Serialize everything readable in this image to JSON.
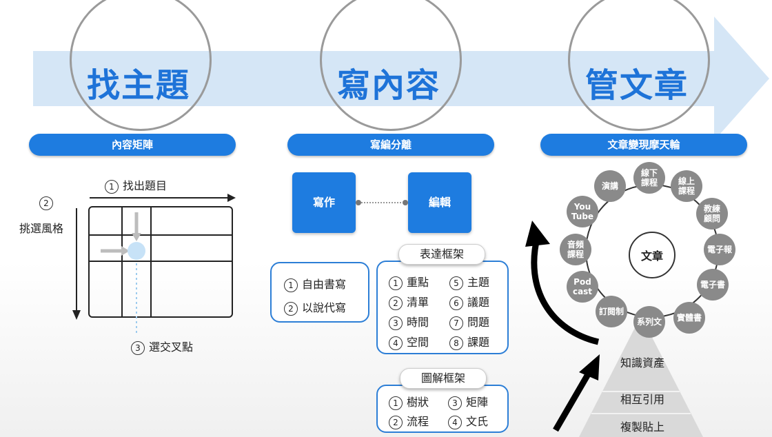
{
  "stages": [
    {
      "title": "找主題",
      "pill": "內容矩陣"
    },
    {
      "title": "寫內容",
      "pill": "寫編分離"
    },
    {
      "title": "管文章",
      "pill": "文章變現摩天輪"
    }
  ],
  "matrix": {
    "step1_num": "1",
    "step1": "找出題目",
    "step2_num": "2",
    "step2": "挑選風格",
    "step3_num": "3",
    "step3": "選交叉點"
  },
  "write_edit": {
    "write": "寫作",
    "edit": "編輯",
    "left_items": [
      {
        "num": "1",
        "text": "自由書寫"
      },
      {
        "num": "2",
        "text": "以說代寫"
      }
    ],
    "expression_title": "表達框架",
    "expression_items": [
      {
        "num": "1",
        "text": "重點"
      },
      {
        "num": "5",
        "text": "主題"
      },
      {
        "num": "2",
        "text": "清單"
      },
      {
        "num": "6",
        "text": "議題"
      },
      {
        "num": "3",
        "text": "時間"
      },
      {
        "num": "7",
        "text": "問題"
      },
      {
        "num": "4",
        "text": "空間"
      },
      {
        "num": "8",
        "text": "課題"
      }
    ],
    "diagram_title": "圖解框架",
    "diagram_items": [
      {
        "num": "1",
        "text": "樹狀"
      },
      {
        "num": "3",
        "text": "矩陣"
      },
      {
        "num": "2",
        "text": "流程"
      },
      {
        "num": "4",
        "text": "文氏"
      }
    ]
  },
  "wheel": {
    "center": "文章",
    "nodes": [
      "線下課程",
      "線上課程",
      "教練顧問",
      "電子報",
      "電子書",
      "實體書",
      "系列文",
      "訂閱制",
      "Podcast",
      "音頻課程",
      "YouTube",
      "演講"
    ],
    "node_lines": [
      [
        "線下",
        "課程"
      ],
      [
        "線上",
        "課程"
      ],
      [
        "教練",
        "顧問"
      ],
      [
        "電子報"
      ],
      [
        "電子書"
      ],
      [
        "實體書"
      ],
      [
        "系列文"
      ],
      [
        "訂閱制"
      ],
      [
        "Pod",
        "cast"
      ],
      [
        "音頻",
        "課程"
      ],
      [
        "You",
        "Tube"
      ],
      [
        "演講"
      ]
    ],
    "pyramid": [
      "知識資產",
      "相互引用",
      "複製貼上"
    ]
  },
  "colors": {
    "accent": "#1e7ce0",
    "arrow": "#d5e6f6",
    "node": "#8a8a8a"
  }
}
